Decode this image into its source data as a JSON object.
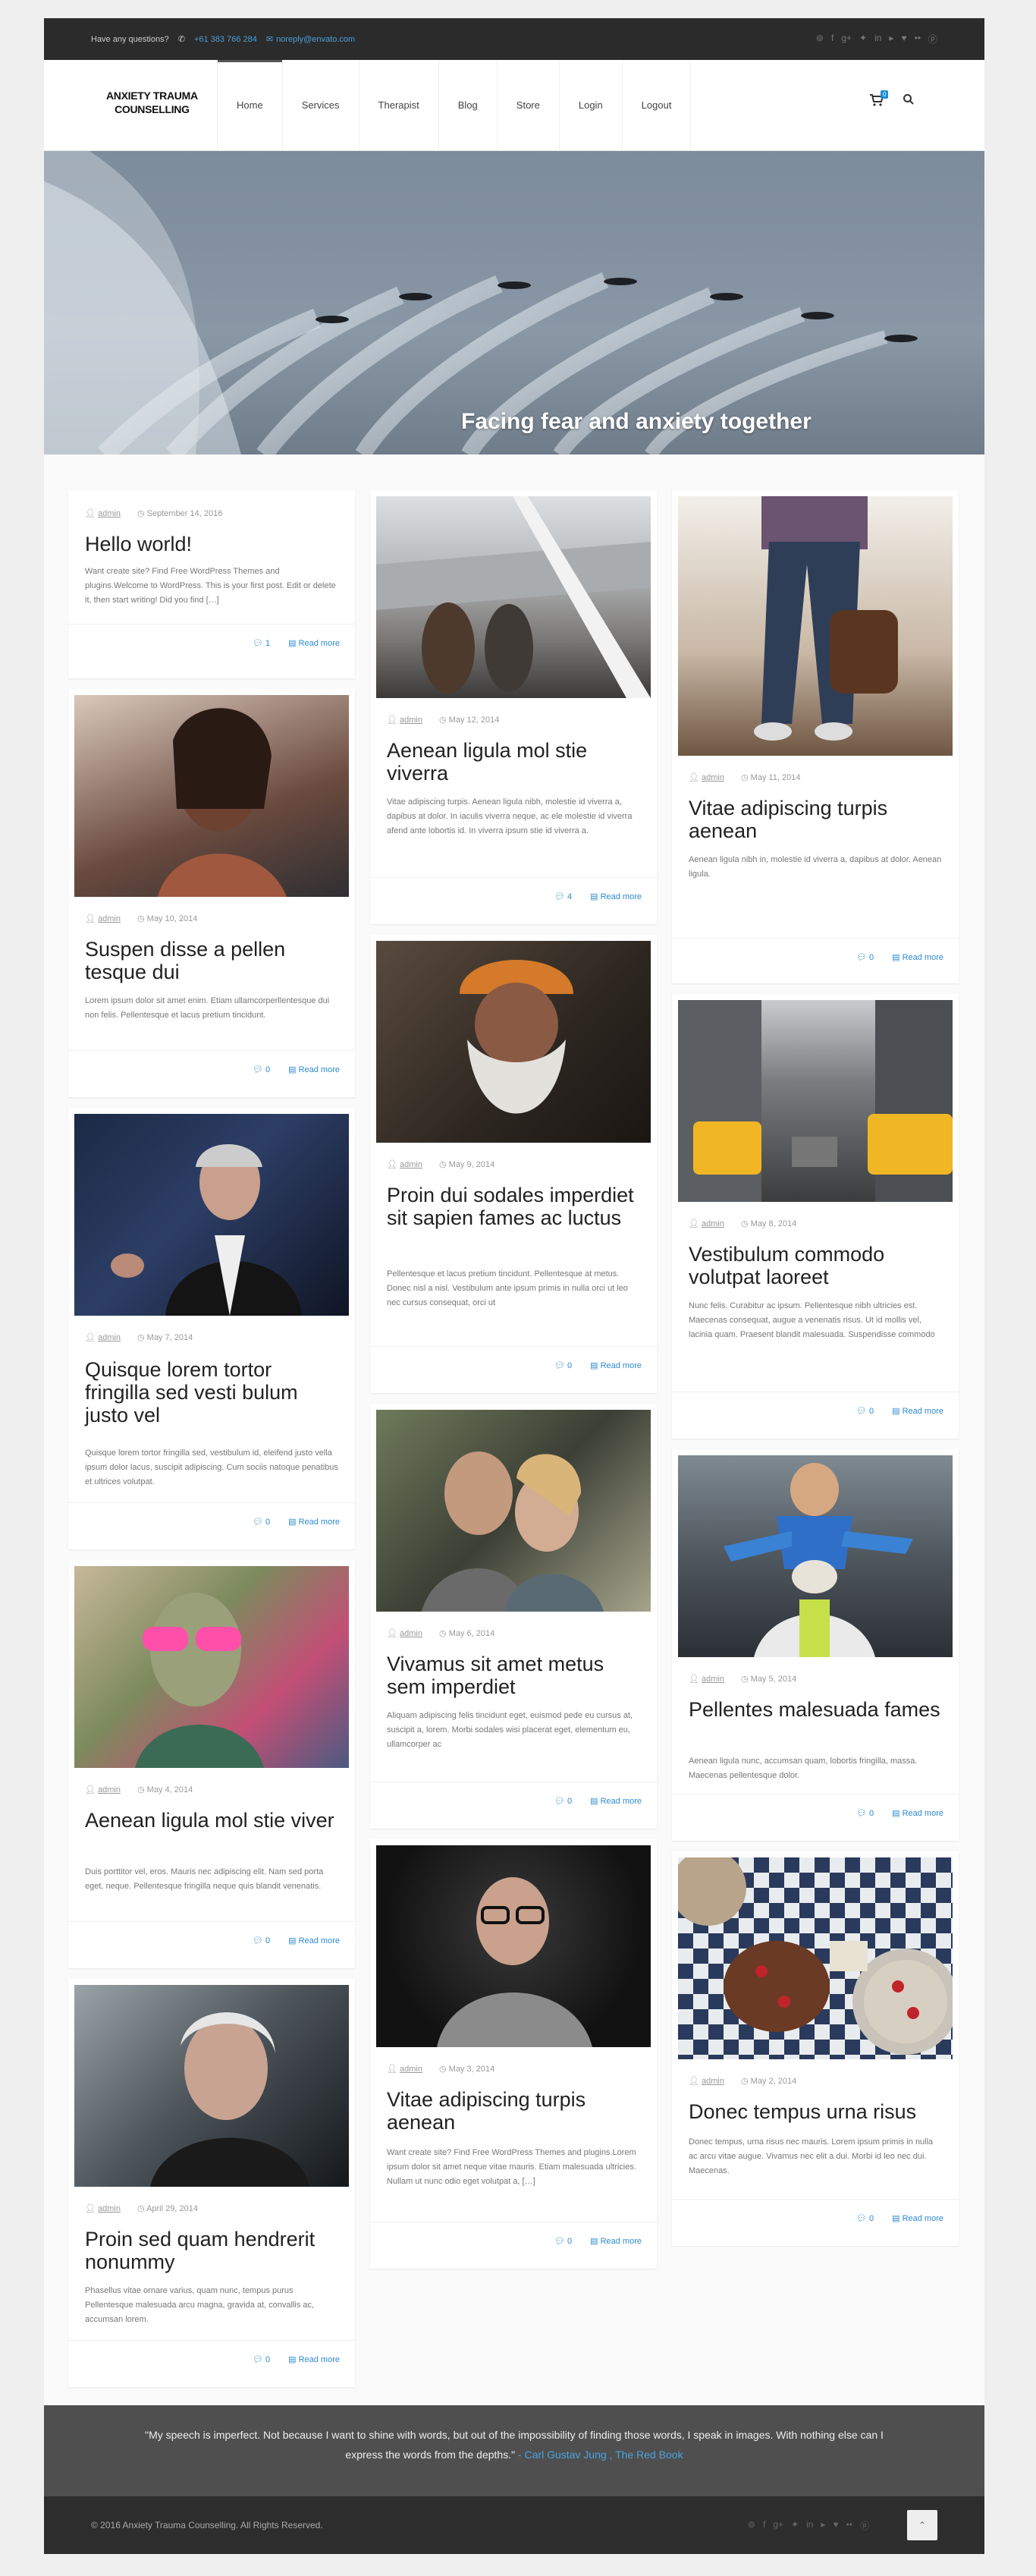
{
  "topbar": {
    "question": "Have any questions?",
    "phone": "+61 383 766 284",
    "email": "noreply@envato.com",
    "social": [
      "⊚",
      "f",
      "g+",
      "✦",
      "in",
      "▸",
      "♥",
      "••",
      "ⓟ"
    ]
  },
  "header": {
    "logo_line1": "ANXIETY TRAUMA",
    "logo_line2": "COUNSELLING",
    "nav": [
      "Home",
      "Services",
      "Therapist",
      "Blog",
      "Store",
      "Login",
      "Logout"
    ],
    "cart_count": "0"
  },
  "hero": {
    "title": "Facing fear and anxiety together"
  },
  "posts": [
    {
      "author": "admin",
      "date": "September 14, 2016",
      "title": "Hello world!",
      "excerpt": "Want create site? Find Free WordPress Themes and plugins.Welcome to WordPress. This is your first post. Edit or delete it, then start writing! Did you find […]",
      "comments": "1",
      "read": "Read more"
    },
    {
      "author": "admin",
      "date": "May 10, 2014",
      "title": "Suspen disse a pellen tesque dui",
      "excerpt": "Lorem ipsum dolor sit amet enim. Etiam ullamcorperllentesque dui non felis. Pellentesque et lacus pretium tincidunt.",
      "comments": "0",
      "read": "Read more"
    },
    {
      "author": "admin",
      "date": "May 7, 2014",
      "title": "Quisque lorem tortor fringilla sed vesti bulum justo vel",
      "excerpt": "Quisque lorem tortor fringilla sed, vestibulum id, eleifend justo vella ipsum dolor lacus, suscipit adipiscing. Cum sociis natoque penatibus et ultrices volutpat.",
      "comments": "0",
      "read": "Read more"
    },
    {
      "author": "admin",
      "date": "May 4, 2014",
      "title": "Aenean ligula mol stie viver",
      "excerpt": "Duis porttitor vel, eros. Mauris nec adipiscing elit. Nam sed porta eget, neque. Pellentesque fringilla neque quis blandit venenatis.",
      "comments": "0",
      "read": "Read more"
    },
    {
      "author": "admin",
      "date": "April 29, 2014",
      "title": "Proin sed quam hendrerit nonummy",
      "excerpt": "Phasellus vitae ornare varius, quam nunc, tempus purus Pellentesque malesuada arcu magna, gravida at, convallis ac, accumsan lorem.",
      "comments": "0",
      "read": "Read more"
    },
    {
      "author": "admin",
      "date": "May 12, 2014",
      "title": "Aenean ligula mol stie viverra",
      "excerpt": "Vitae adipiscing turpis. Aenean ligula nibh, molestie id viverra a, dapibus at dolor. In iaculis viverra neque, ac ele molestie id viverra afend ante lobortis id. In viverra ipsum stie id viverra a.",
      "comments": "4",
      "read": "Read more"
    },
    {
      "author": "admin",
      "date": "May 9, 2014",
      "title": "Proin dui sodales imperdiet sit sapien fames ac luctus",
      "excerpt": "Pellentesque et lacus pretium tincidunt. Pellentesque at metus. Donec nisl a nisl. Vestibulum ante ipsum primis in nulla orci ut leo nec cursus consequat, orci ut",
      "comments": "0",
      "read": "Read more"
    },
    {
      "author": "admin",
      "date": "May 6, 2014",
      "title": "Vivamus sit amet metus sem imperdiet",
      "excerpt": "Aliquam adipiscing felis tincidunt eget, euismod pede eu cursus at, suscipit a, lorem. Morbi sodales wisi placerat eget, elementum eu, ullamcorper ac",
      "comments": "0",
      "read": "Read more"
    },
    {
      "author": "admin",
      "date": "May 3, 2014",
      "title": "Vitae adipiscing turpis aenean",
      "excerpt": "Want create site? Find Free WordPress Themes and plugins.Lorem ipsum dolor sit amet neque vitae mauris. Etiam malesuada ultricies. Nullam ut nunc odio eget volutpat a, […]",
      "comments": "0",
      "read": "Read more"
    },
    {
      "author": "admin",
      "date": "May 11, 2014",
      "title": "Vitae adipiscing turpis aenean",
      "excerpt": "Aenean ligula nibh in, molestie id viverra a, dapibus at dolor. Aenean ligula.",
      "comments": "0",
      "read": "Read more"
    },
    {
      "author": "admin",
      "date": "May 8, 2014",
      "title": "Vestibulum commodo volutpat laoreet",
      "excerpt": "Nunc felis. Curabitur ac ipsum. Pellentesque nibh ultricies est. Maecenas consequat, augue a venenatis risus. Ut id mollis vel, lacinia quam. Praesent blandit malesuada. Suspendisse commodo",
      "comments": "0",
      "read": "Read more"
    },
    {
      "author": "admin",
      "date": "May 5, 2014",
      "title": "Pellentes malesuada fames",
      "excerpt": "Aenean ligula nunc, accumsan quam, lobortis fringilla, massa. Maecenas pellentesque dolor.",
      "comments": "0",
      "read": "Read more"
    },
    {
      "author": "admin",
      "date": "May 2, 2014",
      "title": "Donec tempus urna risus",
      "excerpt": "Donec tempus, urna risus nec mauris. Lorem ipsum primis in nulla ac arcu vitae augue. Vivamus nec elit a dui. Morbi id leo nec dui. Maecenas.",
      "comments": "0",
      "read": "Read more"
    }
  ],
  "quote": {
    "text": "\"My speech is imperfect. Not because I want to shine with words, but out of the impossibility of finding those words, I speak in images. With nothing else can I express the words from the depths.\"",
    "source": "- Carl Gustav Jung , The Red Book"
  },
  "footer": {
    "copyright": "© 2016 Anxiety Trauma Counselling. All Rights Reserved.",
    "social": [
      "⊚",
      "f",
      "g+",
      "✦",
      "in",
      "▸",
      "♥",
      "••",
      "ⓟ"
    ],
    "top": "⌃"
  }
}
